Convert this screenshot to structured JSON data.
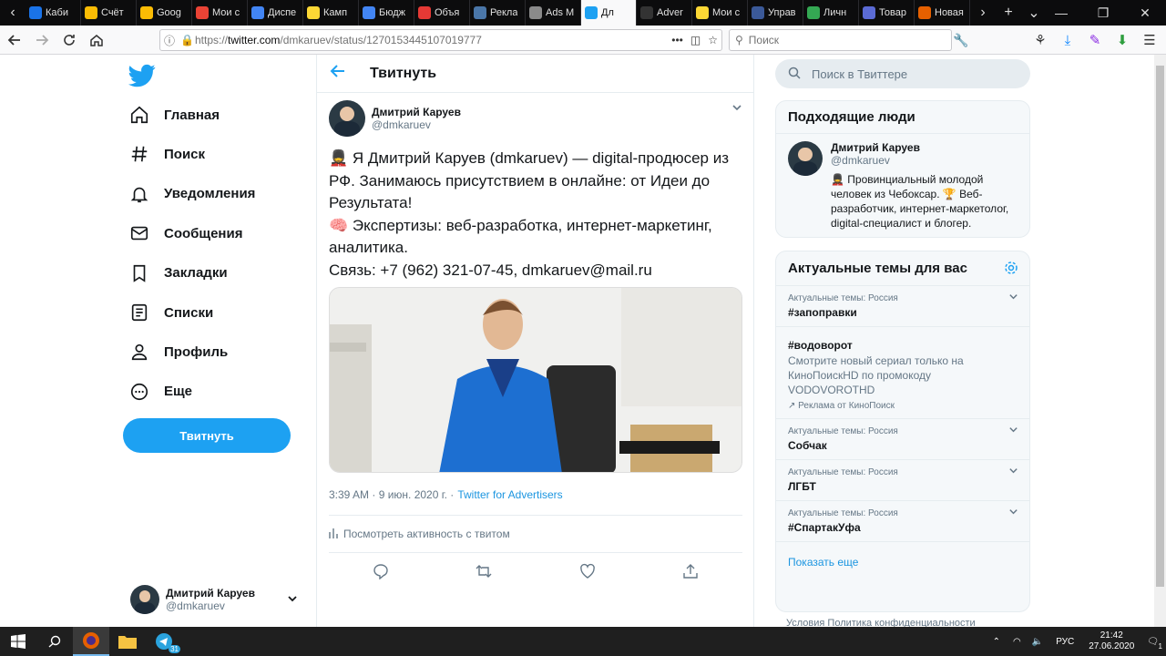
{
  "browser": {
    "tabs": [
      {
        "label": "Каби",
        "color": "#1a73e8"
      },
      {
        "label": "Счёт",
        "color": "#fbbc04"
      },
      {
        "label": "Goog",
        "color": "#fbbc04"
      },
      {
        "label": "Мои с",
        "color": "#ea4335"
      },
      {
        "label": "Диспе",
        "color": "#4285f4"
      },
      {
        "label": "Камп",
        "color": "#fdd835"
      },
      {
        "label": "Бюдж",
        "color": "#4285f4"
      },
      {
        "label": "Объя",
        "color": "#e53935"
      },
      {
        "label": "Рекла",
        "color": "#4a76a8"
      },
      {
        "label": "Ads M",
        "color": "#8a8a8a"
      },
      {
        "label": "Дл",
        "color": "#1da1f2",
        "active": true
      },
      {
        "label": "Adver",
        "color": "#333333"
      },
      {
        "label": "Мои с",
        "color": "#fdd835"
      },
      {
        "label": "Управ",
        "color": "#3b5998"
      },
      {
        "label": "Личн",
        "color": "#34a853"
      },
      {
        "label": "Товар",
        "color": "#5b6bd5"
      },
      {
        "label": "Новая",
        "color": "#e66000"
      }
    ],
    "url_prefix": "https://",
    "url_host": "twitter.com",
    "url_path": "/dmkaruev/status/1270153445107019777",
    "search_placeholder": "Поиск"
  },
  "nav": {
    "items": [
      {
        "label": "Главная",
        "icon": "home-icon"
      },
      {
        "label": "Поиск",
        "icon": "hashtag-icon"
      },
      {
        "label": "Уведомления",
        "icon": "bell-icon"
      },
      {
        "label": "Сообщения",
        "icon": "mail-icon"
      },
      {
        "label": "Закладки",
        "icon": "bookmark-icon"
      },
      {
        "label": "Списки",
        "icon": "list-icon"
      },
      {
        "label": "Профиль",
        "icon": "profile-icon"
      },
      {
        "label": "Еще",
        "icon": "more-icon"
      }
    ],
    "tweet_button": "Твитнуть",
    "account": {
      "name": "Дмитрий Каруев",
      "handle": "@dmkaruev"
    }
  },
  "main": {
    "title": "Твитнуть",
    "tweet": {
      "author_name": "Дмитрий Каруев",
      "author_handle": "@dmkaruev",
      "lines": [
        "💂 Я Дмитрий Каруев (dmkaruev) — digital-продюсер из РФ. Занимаюсь присутствием в онлайне: от Идеи до Результата!",
        "🧠 Экспертизы: веб-разработка, интернет-маркетинг, аналитика.",
        "Связь: +7 (962) 321-07-45, dmkaruev@mail.ru"
      ],
      "timestamp": "3:39 AM · 9 июн. 2020 г. ·",
      "source": "Twitter for Advertisers",
      "activity": "Посмотреть активность с твитом"
    }
  },
  "sidebar": {
    "search_placeholder": "Поиск в Твиттере",
    "people_title": "Подходящие люди",
    "person": {
      "name": "Дмитрий Каруев",
      "handle": "@dmkaruev",
      "bio": "💂 Провинциальный молодой человек из Чебоксар. 🏆 Веб-разработчик, интернет-маркетолог, digital-специалист и блогер."
    },
    "trends_title": "Актуальные темы для вас",
    "trends": [
      {
        "category": "Актуальные темы: Россия",
        "name": "#запоправки"
      },
      {
        "category": "",
        "name": "#водоворот",
        "description": "Смотрите новый сериал только на КиноПоискHD по промокоду VODOVOROTHD",
        "promo": "Реклама от КиноПоиск"
      },
      {
        "category": "Актуальные темы: Россия",
        "name": "Собчак"
      },
      {
        "category": "Актуальные темы: Россия",
        "name": "ЛГБТ"
      },
      {
        "category": "Актуальные темы: Россия",
        "name": "#СпартакУфа"
      }
    ],
    "show_more": "Показать еще",
    "footer": "Условия   Политика конфиденциальности"
  },
  "taskbar": {
    "lang": "РУС",
    "time": "21:42",
    "date": "27.06.2020",
    "badge": "31",
    "notifications": "1"
  }
}
